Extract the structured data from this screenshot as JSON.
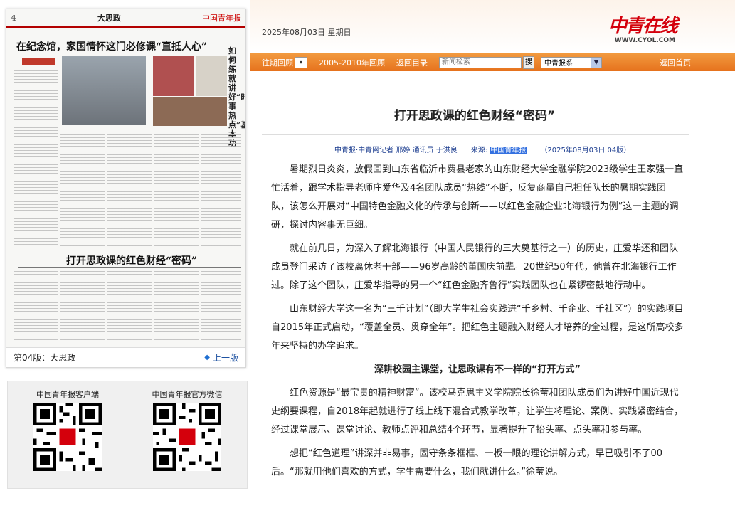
{
  "date": "2025年08月03日 星期日",
  "brand": {
    "name": "中青在线",
    "url": "WWW.CYOL.COM"
  },
  "nav": {
    "review": "往期回顾",
    "archive": "2005-2010年回顾",
    "back_list": "返回目录",
    "search_placeholder": "新闻检索",
    "search_button": "搜",
    "paper_select": "中青报系",
    "home": "返回首页"
  },
  "article": {
    "title": "打开思政课的红色财经“密码”",
    "byline_authors": "中青报·中青网记者 邢婷 通讯员 于洪良",
    "byline_source_label": "来源:",
    "byline_source": "中国青年报",
    "byline_date": "（2025年08月03日 04版）",
    "paragraphs": [
      "暑期烈日炎炎，放假回到山东省临沂市费县老家的山东财经大学金融学院2023级学生王家强一直忙活着，跟学术指导老师庄爱华及4名团队成员“热线”不断，反复商量自己担任队长的暑期实践团队，该怎么开展对“中国特色金融文化的传承与创新——以红色金融企业北海银行为例”这一主题的调研，探讨内容事无巨细。",
      "就在前几日，为深入了解北海银行（中国人民银行的三大奠基行之一）的历史，庄爱华还和团队成员登门采访了该校离休老干部——96岁高龄的董国庆前辈。20世纪50年代，他曾在北海银行工作过。除了这个团队，庄爱华指导的另一个“红色金融齐鲁行”实践团队也在紧锣密鼓地行动中。",
      "山东财经大学这一名为“三千计划”（即大学生社会实践进“千乡村、千企业、千社区”）的实践项目自2015年正式启动，“覆盖全员、贯穿全年”。把红色主题融入财经人才培养的全过程，是这所高校多年来坚持的办学追求。"
    ],
    "subheading": "深耕校园主课堂，让思政课有不一样的“打开方式”",
    "paragraphs2": [
      "红色资源是“最宝贵的精神财富”。该校马克思主义学院院长徐莹和团队成员们为讲好中国近现代史纲要课程，自2018年起就进行了线上线下混合式教学改革，让学生将理论、案例、实践紧密结合，经过课堂展示、课堂讨论、教师点评和总结4个环节，显著提升了抬头率、点头率和参与率。",
      "想把“红色道理”讲深并非易事，固守条条框框、一板一眼的理论讲解方式，早已吸引不了00后。“那就用他们喜欢的方式，学生需要什么，我们就讲什么。”徐莹说。"
    ]
  },
  "paper": {
    "page_num": "4",
    "section": "大思政",
    "headline_top": "在纪念馆，家国情怀这门必修课“直抵人心”",
    "side_title": "如何练就讲好“时事热点”基本功",
    "headline_main": "打开思政课的红色财经“密码”",
    "footer_page": "第04版：大思政",
    "prev": "上一版"
  },
  "qr": {
    "client_label": "中国青年报客户端",
    "wechat_label": "中国青年报官方微信"
  }
}
